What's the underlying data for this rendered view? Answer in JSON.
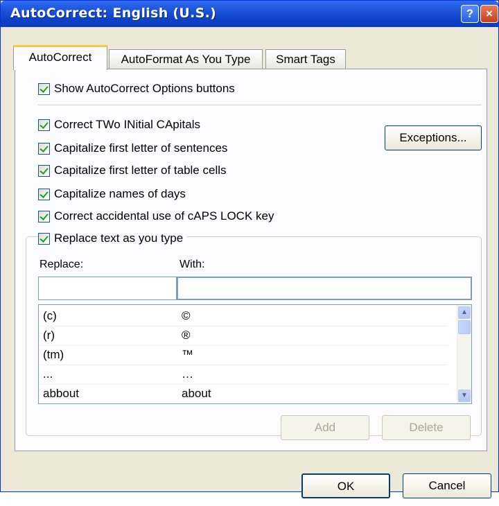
{
  "window": {
    "title": "AutoCorrect: English (U.S.)",
    "help_label": "?",
    "close_label": "×"
  },
  "tabs": [
    {
      "label": "AutoCorrect",
      "active": true
    },
    {
      "label": "AutoFormat As You Type",
      "active": false
    },
    {
      "label": "Smart Tags",
      "active": false
    }
  ],
  "options": {
    "show_buttons": {
      "label": "Show AutoCorrect Options buttons",
      "checked": true
    },
    "two_initial_caps": {
      "label": "Correct TWo INitial CApitals",
      "checked": true
    },
    "first_letter_sentences": {
      "label": "Capitalize first letter of sentences",
      "checked": true
    },
    "first_letter_table_cells": {
      "label": "Capitalize first letter of table cells",
      "checked": true
    },
    "names_of_days": {
      "label": "Capitalize names of days",
      "checked": true
    },
    "caps_lock": {
      "label": "Correct accidental use of cAPS LOCK key",
      "checked": true
    },
    "replace_text": {
      "label": "Replace text as you type",
      "checked": true
    }
  },
  "exceptions_label": "Exceptions...",
  "replace": {
    "replace_label": "Replace:",
    "with_label": "With:",
    "replace_value": "",
    "with_value": ""
  },
  "entries": [
    {
      "replace": "(c)",
      "with": "©"
    },
    {
      "replace": "(r)",
      "with": "®"
    },
    {
      "replace": "(tm)",
      "with": "™"
    },
    {
      "replace": "...",
      "with": "…"
    },
    {
      "replace": "abbout",
      "with": "about"
    }
  ],
  "add_label": "Add",
  "delete_label": "Delete",
  "ok_label": "OK",
  "cancel_label": "Cancel",
  "colors": {
    "titlebar": "#0d43c8",
    "dialog_bg": "#ece9d8",
    "tab_highlight": "#ffc83c",
    "checkmark": "#21a121"
  }
}
